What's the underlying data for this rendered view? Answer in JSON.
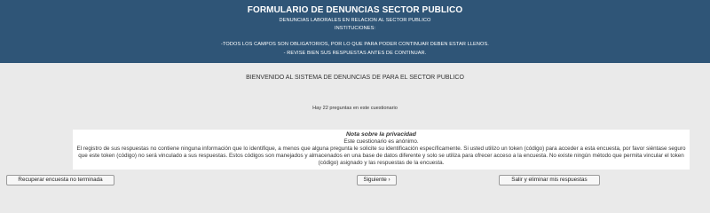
{
  "header": {
    "title": "FORMULARIO DE DENUNCIAS SECTOR PUBLICO",
    "subtitle": "DENUNCIAS LABORALES EN RELACION AL SECTOR PUBLICO",
    "institutions": "INSTITUCIONES:",
    "notice_required": "-TODOS LOS CAMPOS SON OBLIGATORIOS, POR LO QUE PARA PODER CONTINUAR DEBEN ESTAR LLENOS.",
    "notice_review": "- REVISE BIEN SUS RESPUESTAS ANTES DE CONTINUAR.",
    "background_color": "#2f5577"
  },
  "main": {
    "welcome": "BIENVENIDO AL SISTEMA DE DENUNCIAS DE PARA EL SECTOR PUBLICO",
    "question_count": "Hay 22 preguntas en este cuestionario"
  },
  "privacy": {
    "title": "Nota sobre la privacidad",
    "line1": "Este cuestionario es anónimo.",
    "body": "El registro de sus respuestas no contiene ninguna información que lo identifique, a menos que alguna pregunta le solicite su identificación específicamente. Si usted utilizo un token (código) para acceder a esta encuesta, por favor siéntase seguro que este token (código) no será vinculado a sus respuestas. Estos códigos son manejados y almacenados en una base de datos diferente y solo se utiliza para ofrecer acceso a la encuesta. No existe ningún método que permita vincular el token (código) asignado y las respuestas de la encuesta."
  },
  "buttons": {
    "resume": "Recuperar encuesta no terminada",
    "next": "Siguiente ›",
    "exit": "Salir y eliminar mis respuestas"
  }
}
